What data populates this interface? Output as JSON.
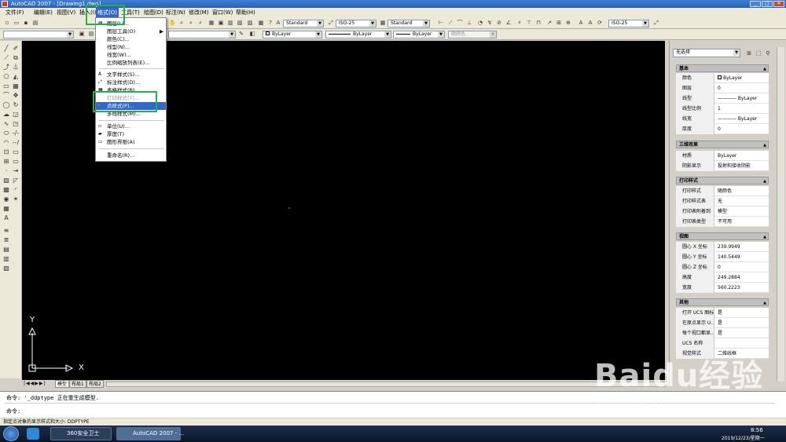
{
  "window": {
    "title": "AutoCAD 2007 - [Drawing1.dwg]",
    "min": "_",
    "max": "□",
    "close": "✕"
  },
  "menubar": {
    "items": [
      "文件(F)",
      "编辑(E)",
      "视图(V)",
      "插入(I)",
      "格式(O)",
      "工具(T)",
      "绘图(D)",
      "标注(N)",
      "修改(M)",
      "窗口(W)",
      "帮助(H)"
    ]
  },
  "toolbar": {
    "text_style": "Standard",
    "dim_style": "ISO-25",
    "table_style": "Standard",
    "dim_style2": "ISO-25",
    "color": "ByLayer",
    "linetype": "ByLayer",
    "lineweight": "ByLayer",
    "plotstyle": "随颜色"
  },
  "format_menu": {
    "items": [
      "图层(L)...",
      "图层工具(O)",
      "颜色(C)...",
      "线型(N)...",
      "线宽(W)...",
      "比例缩放列表(E)...",
      "文字样式(S)...",
      "标注样式(D)...",
      "表格样式(B)...",
      "打印样式(Y)...",
      "点样式(P)...",
      "多线样式(M)...",
      "单位(U)...",
      "厚度(T)",
      "图形界限(A)",
      "重命名(R)..."
    ]
  },
  "canvas": {
    "ucs_x": "X",
    "ucs_y": "Y"
  },
  "layout_tabs": [
    "模型",
    "布局1",
    "布局2"
  ],
  "command": {
    "line1": "命令: '_ddptype 正在重生成模型.",
    "prompt": "命令:"
  },
  "status": {
    "text": "指定点对象的显示样式和大小:   DDPTYPE"
  },
  "properties": {
    "selector": "无选择",
    "sections": [
      {
        "title": "基本",
        "rows": [
          [
            "颜色",
            "ByLayer"
          ],
          [
            "图层",
            "0"
          ],
          [
            "线型",
            "———— ByLayer"
          ],
          [
            "线型比例",
            "1"
          ],
          [
            "线宽",
            "———— ByLayer"
          ],
          [
            "厚度",
            "0"
          ]
        ]
      },
      {
        "title": "三维效果",
        "rows": [
          [
            "材质",
            "ByLayer"
          ],
          [
            "阴影显示",
            "投射和接收阴影"
          ]
        ]
      },
      {
        "title": "打印样式",
        "rows": [
          [
            "打印样式",
            "随颜色"
          ],
          [
            "打印样式表",
            "无"
          ],
          [
            "打印表附着到",
            "模型"
          ],
          [
            "打印表类型",
            "不可用"
          ]
        ]
      },
      {
        "title": "视图",
        "rows": [
          [
            "圆心 X 坐标",
            "239.9949"
          ],
          [
            "圆心 Y 坐标",
            "140.5449"
          ],
          [
            "圆心 Z 坐标",
            "0"
          ],
          [
            "高度",
            "249.2884"
          ],
          [
            "宽度",
            "560.2223"
          ]
        ]
      },
      {
        "title": "其他",
        "rows": [
          [
            "打开 UCS 图标",
            "是"
          ],
          [
            "在原点显示 U...",
            "是"
          ],
          [
            "每个视口都显...",
            "是"
          ],
          [
            "UCS 名称",
            ""
          ],
          [
            "视觉样式",
            "二维线框"
          ]
        ]
      }
    ]
  },
  "taskbar": {
    "tasks": [
      "360安全卫士",
      "AutoCAD 2007 - ..."
    ],
    "time": "8:56",
    "date": "2019/12/23/星期一"
  },
  "watermark": {
    "brand": "Baidu经验",
    "url": "jingyan.baidu.com"
  }
}
